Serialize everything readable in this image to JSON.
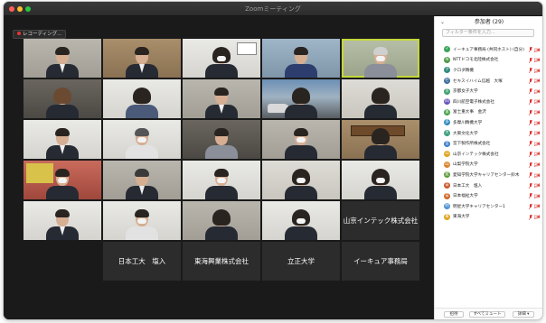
{
  "window": {
    "title": "Zoomミーティング"
  },
  "recording": {
    "label": "レコーディング..."
  },
  "participants_panel": {
    "title": "参加者 (29)",
    "search_placeholder": "フィルター条件を入力...",
    "items": [
      {
        "initial": "イ",
        "name": "イーキュア事務局 (共同ホスト) (自分)",
        "color": "#3aa35a"
      },
      {
        "initial": "N",
        "name": "NTTドコモ北陸株式会社",
        "color": "#4e9b47"
      },
      {
        "initial": "ク",
        "name": "クロダ精機",
        "color": "#2f8a7a"
      },
      {
        "initial": "セ",
        "name": "セキスイハイム信越　大塚",
        "color": "#3e6e9e"
      },
      {
        "initial": "京",
        "name": "京都女子大学",
        "color": "#3d9e6b"
      },
      {
        "initial": "四",
        "name": "四川航空電子株式会社",
        "color": "#6a55b8"
      },
      {
        "initial": "富",
        "name": "富士重大事　金沢",
        "color": "#43a047"
      },
      {
        "initial": "多",
        "name": "多摩川精機大学",
        "color": "#2e8bc0"
      },
      {
        "initial": "大",
        "name": "大東文化大学",
        "color": "#3a9d7e"
      },
      {
        "initial": "宮",
        "name": "宮下製作所株式会社",
        "color": "#3f7fc8"
      },
      {
        "initial": "山",
        "name": "山京インテック株式会社",
        "color": "#e0a21b"
      },
      {
        "initial": "山",
        "name": "山梨学院大学",
        "color": "#d9822b"
      },
      {
        "initial": "愛",
        "name": "愛知学院大学キャリアセンター鈴木",
        "color": "#5a9c3a"
      },
      {
        "initial": "日",
        "name": "日本工大　塩入",
        "color": "#c95b2e"
      },
      {
        "initial": "日",
        "name": "日本福祉大学",
        "color": "#d06b2a"
      },
      {
        "initial": "明",
        "name": "明星大学キャリアセンター1",
        "color": "#4a8fd0"
      },
      {
        "initial": "東",
        "name": "東海大学",
        "color": "#e0a21b"
      }
    ],
    "footer": {
      "invite": "招待",
      "mute_all": "すべてミュート",
      "more": "詳細 ▾"
    }
  },
  "video_grid": {
    "name_tiles": [
      "山京インテック株式会社",
      "日本工大　塩入",
      "東海興業株式会社",
      "立正大学",
      "イーキュア事務局"
    ]
  },
  "colors": {
    "active_speaker": "#c4d83a",
    "muted_icon": "#d9302c",
    "panel_bg": "#ffffff",
    "stage_bg": "#1a1a1a"
  }
}
